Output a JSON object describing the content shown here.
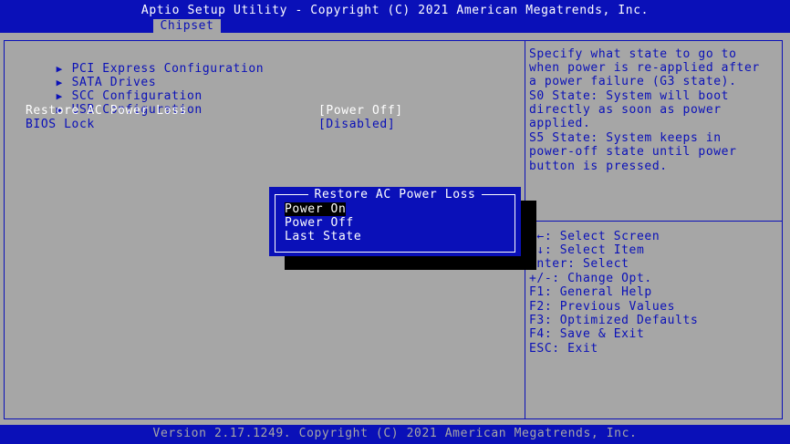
{
  "header": {
    "title": "Aptio Setup Utility - Copyright (C) 2021 American Megatrends, Inc.",
    "tab": "Chipset"
  },
  "menu": {
    "submenus": [
      {
        "arrow": "▶",
        "label": "PCI Express Configuration"
      },
      {
        "arrow": "▶",
        "label": "SATA Drives"
      },
      {
        "arrow": "▶",
        "label": "SCC Configuration"
      },
      {
        "arrow": "▶",
        "label": "USB Configuration"
      }
    ],
    "settings": [
      {
        "label": "Restore AC Power Loss",
        "value": "[Power Off]",
        "selected": true
      },
      {
        "label": "BIOS Lock",
        "value": "[Disabled]",
        "selected": false
      }
    ]
  },
  "help": {
    "description": [
      "Specify what state to go to",
      "when power is re-applied after",
      "a power failure (G3 state).",
      "S0 State: System will boot",
      "directly as soon as power",
      "applied.",
      "S5 State: System keeps in",
      "power-off state until power",
      "button is pressed."
    ],
    "keys": [
      "→←: Select Screen",
      "↑↓: Select Item",
      "Enter: Select",
      "+/-: Change Opt.",
      "F1: General Help",
      "F2: Previous Values",
      "F3: Optimized Defaults",
      "F4: Save & Exit",
      "ESC: Exit"
    ]
  },
  "popup": {
    "title": "Restore AC Power Loss",
    "options": [
      "Power On",
      "Power Off",
      "Last State"
    ],
    "highlighted": "Power On"
  },
  "footer": {
    "text": "Version 2.17.1249. Copyright (C) 2021 American Megatrends, Inc."
  },
  "colors": {
    "bios_blue": "#0a10b8",
    "bios_gray": "#a6a6a6",
    "highlight_white": "#ffffff",
    "shadow_black": "#000000"
  }
}
